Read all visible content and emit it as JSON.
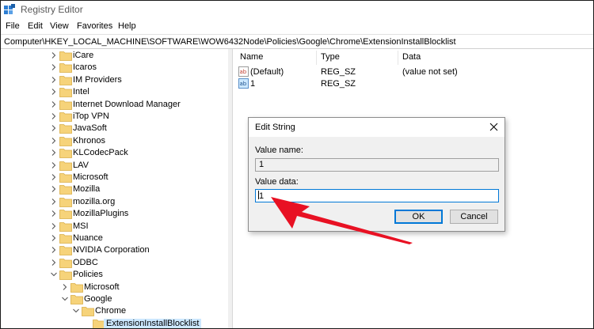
{
  "window": {
    "title": "Registry Editor"
  },
  "menu": [
    "File",
    "Edit",
    "View",
    "Favorites",
    "Help"
  ],
  "address": "Computer\\HKEY_LOCAL_MACHINE\\SOFTWARE\\WOW6432Node\\Policies\\Google\\Chrome\\ExtensionInstallBlocklist",
  "tree": [
    {
      "label": "iCare",
      "expanded": false,
      "level": 0
    },
    {
      "label": "Icaros",
      "expanded": false,
      "level": 0
    },
    {
      "label": "IM Providers",
      "expanded": false,
      "level": 0
    },
    {
      "label": "Intel",
      "expanded": false,
      "level": 0
    },
    {
      "label": "Internet Download Manager",
      "expanded": false,
      "level": 0
    },
    {
      "label": "iTop VPN",
      "expanded": false,
      "level": 0
    },
    {
      "label": "JavaSoft",
      "expanded": false,
      "level": 0
    },
    {
      "label": "Khronos",
      "expanded": false,
      "level": 0
    },
    {
      "label": "KLCodecPack",
      "expanded": false,
      "level": 0
    },
    {
      "label": "LAV",
      "expanded": false,
      "level": 0
    },
    {
      "label": "Microsoft",
      "expanded": false,
      "level": 0
    },
    {
      "label": "Mozilla",
      "expanded": false,
      "level": 0
    },
    {
      "label": "mozilla.org",
      "expanded": false,
      "level": 0
    },
    {
      "label": "MozillaPlugins",
      "expanded": false,
      "level": 0
    },
    {
      "label": "MSI",
      "expanded": false,
      "level": 0
    },
    {
      "label": "Nuance",
      "expanded": false,
      "level": 0
    },
    {
      "label": "NVIDIA Corporation",
      "expanded": false,
      "level": 0
    },
    {
      "label": "ODBC",
      "expanded": false,
      "level": 0
    },
    {
      "label": "Policies",
      "expanded": true,
      "level": 0
    },
    {
      "label": "Microsoft",
      "expanded": false,
      "level": 1
    },
    {
      "label": "Google",
      "expanded": true,
      "level": 1
    },
    {
      "label": "Chrome",
      "expanded": true,
      "level": 2
    },
    {
      "label": "ExtensionInstallBlocklist",
      "expanded": null,
      "level": 3,
      "selected": true
    }
  ],
  "columns": {
    "name": "Name",
    "type": "Type",
    "data": "Data"
  },
  "values": [
    {
      "name": "(Default)",
      "type": "REG_SZ",
      "data": "(value not set)"
    },
    {
      "name": "1",
      "type": "REG_SZ",
      "data": ""
    }
  ],
  "dialog": {
    "title": "Edit String",
    "value_name_label": "Value name:",
    "value_name": "1",
    "value_data_label": "Value data:",
    "value_data": "1",
    "ok": "OK",
    "cancel": "Cancel"
  },
  "colors": {
    "accent": "#0078d7",
    "selection": "#cce8ff",
    "folder": "#f6d37a",
    "arrow": "#e81123"
  }
}
